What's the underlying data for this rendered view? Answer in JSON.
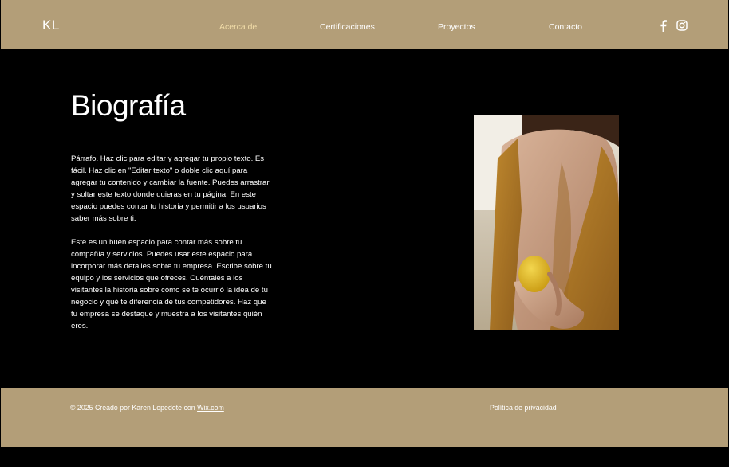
{
  "header": {
    "logo": "KL",
    "nav": [
      {
        "label": "Acerca de"
      },
      {
        "label": "Certificaciones"
      },
      {
        "label": "Proyectos"
      },
      {
        "label": "Contacto"
      }
    ],
    "social": [
      "facebook-icon",
      "instagram-icon"
    ]
  },
  "main": {
    "title": "Biografía",
    "paragraph1": "Párrafo. Haz clic para editar y agregar tu propio texto. Es fácil. Haz clic en \"Editar texto\" o doble clic aquí para agregar tu contenido y cambiar la fuente. Puedes arrastrar y soltar este texto donde quieras en tu página. En este espacio puedes contar tu historia y permitir a los usuarios saber más sobre ti.",
    "paragraph2": "Este es un buen espacio para contar más sobre tu compañía y servicios. Puedes usar este espacio para incorporar más detalles sobre tu empresa. Escribe sobre tu equipo y los servicios que ofreces. Cuéntales a los visitantes la historia sobre cómo se te ocurrió la idea de tu negocio y qué te diferencia de tus competidores. Haz que tu empresa se destaque y muestra a los visitantes quién eres."
  },
  "footer": {
    "copyright_prefix": "© 2025 Creado por Karen Lopedote con ",
    "wix_link": "Wix.com",
    "privacy": "Política de privacidad"
  },
  "colors": {
    "header_bg": "#b39e78",
    "active_nav": "#f1dca8",
    "page_bg": "#000000"
  }
}
